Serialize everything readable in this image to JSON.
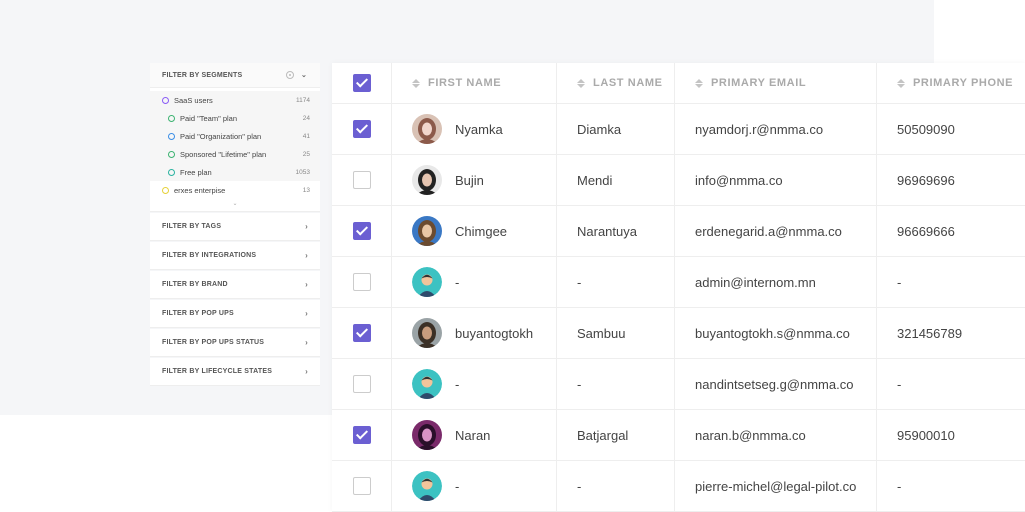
{
  "segments": {
    "header": "FILTER BY SEGMENTS",
    "items": [
      {
        "label": "SaaS users",
        "count": "1174",
        "color": "#8a5cf6"
      },
      {
        "label": "Paid \"Team\" plan",
        "count": "24",
        "color": "#3cb371"
      },
      {
        "label": "Paid \"Organization\" plan",
        "count": "41",
        "color": "#3a8ee6"
      },
      {
        "label": "Sponsored \"Lifetime\" plan",
        "count": "25",
        "color": "#3cb371"
      },
      {
        "label": "Free plan",
        "count": "1053",
        "color": "#2bb3a0"
      },
      {
        "label": "erxes enterpise",
        "count": "13",
        "color": "#e6d13a"
      }
    ],
    "more": "⌄"
  },
  "filters": [
    {
      "label": "FILTER BY TAGS"
    },
    {
      "label": "FILTER BY INTEGRATIONS"
    },
    {
      "label": "FILTER BY BRAND"
    },
    {
      "label": "FILTER BY POP UPS"
    },
    {
      "label": "FILTER BY POP UPS STATUS"
    },
    {
      "label": "FILTER BY LIFECYCLE STATES"
    }
  ],
  "table": {
    "select_all_checked": true,
    "columns": [
      "FIRST NAME",
      "LAST NAME",
      "PRIMARY EMAIL",
      "PRIMARY PHONE"
    ],
    "rows": [
      {
        "checked": true,
        "avatar": "photo-woman",
        "first": "Nyamka",
        "last": "Diamka",
        "email": "nyamdorj.r@nmma.co",
        "phone": "50509090"
      },
      {
        "checked": false,
        "avatar": "photo-woman",
        "first": "Bujin",
        "last": "Mendi",
        "email": "info@nmma.co",
        "phone": "96969696"
      },
      {
        "checked": true,
        "avatar": "photo-woman",
        "first": "Chimgee",
        "last": "Narantuya",
        "email": "erdenegarid.a@nmma.co",
        "phone": "96669666"
      },
      {
        "checked": false,
        "avatar": "default-user-icon",
        "first": "-",
        "last": "-",
        "email": "admin@internom.mn",
        "phone": "-"
      },
      {
        "checked": true,
        "avatar": "photo-man",
        "first": "buyantogtokh",
        "last": "Sambuu",
        "email": "buyantogtokh.s@nmma.co",
        "phone": "321456789"
      },
      {
        "checked": false,
        "avatar": "default-user-icon",
        "first": "-",
        "last": "-",
        "email": "nandintsetseg.g@nmma.co",
        "phone": "-"
      },
      {
        "checked": true,
        "avatar": "photo-woman",
        "first": "Naran",
        "last": "Batjargal",
        "email": "naran.b@nmma.co",
        "phone": "95900010"
      },
      {
        "checked": false,
        "avatar": "default-user-icon",
        "first": "-",
        "last": "-",
        "email": "pierre-michel@legal-pilot.co",
        "phone": "-"
      }
    ]
  },
  "colors": {
    "accent": "#6b5fd2",
    "default_avatar_bg": "#3cc2c2"
  }
}
